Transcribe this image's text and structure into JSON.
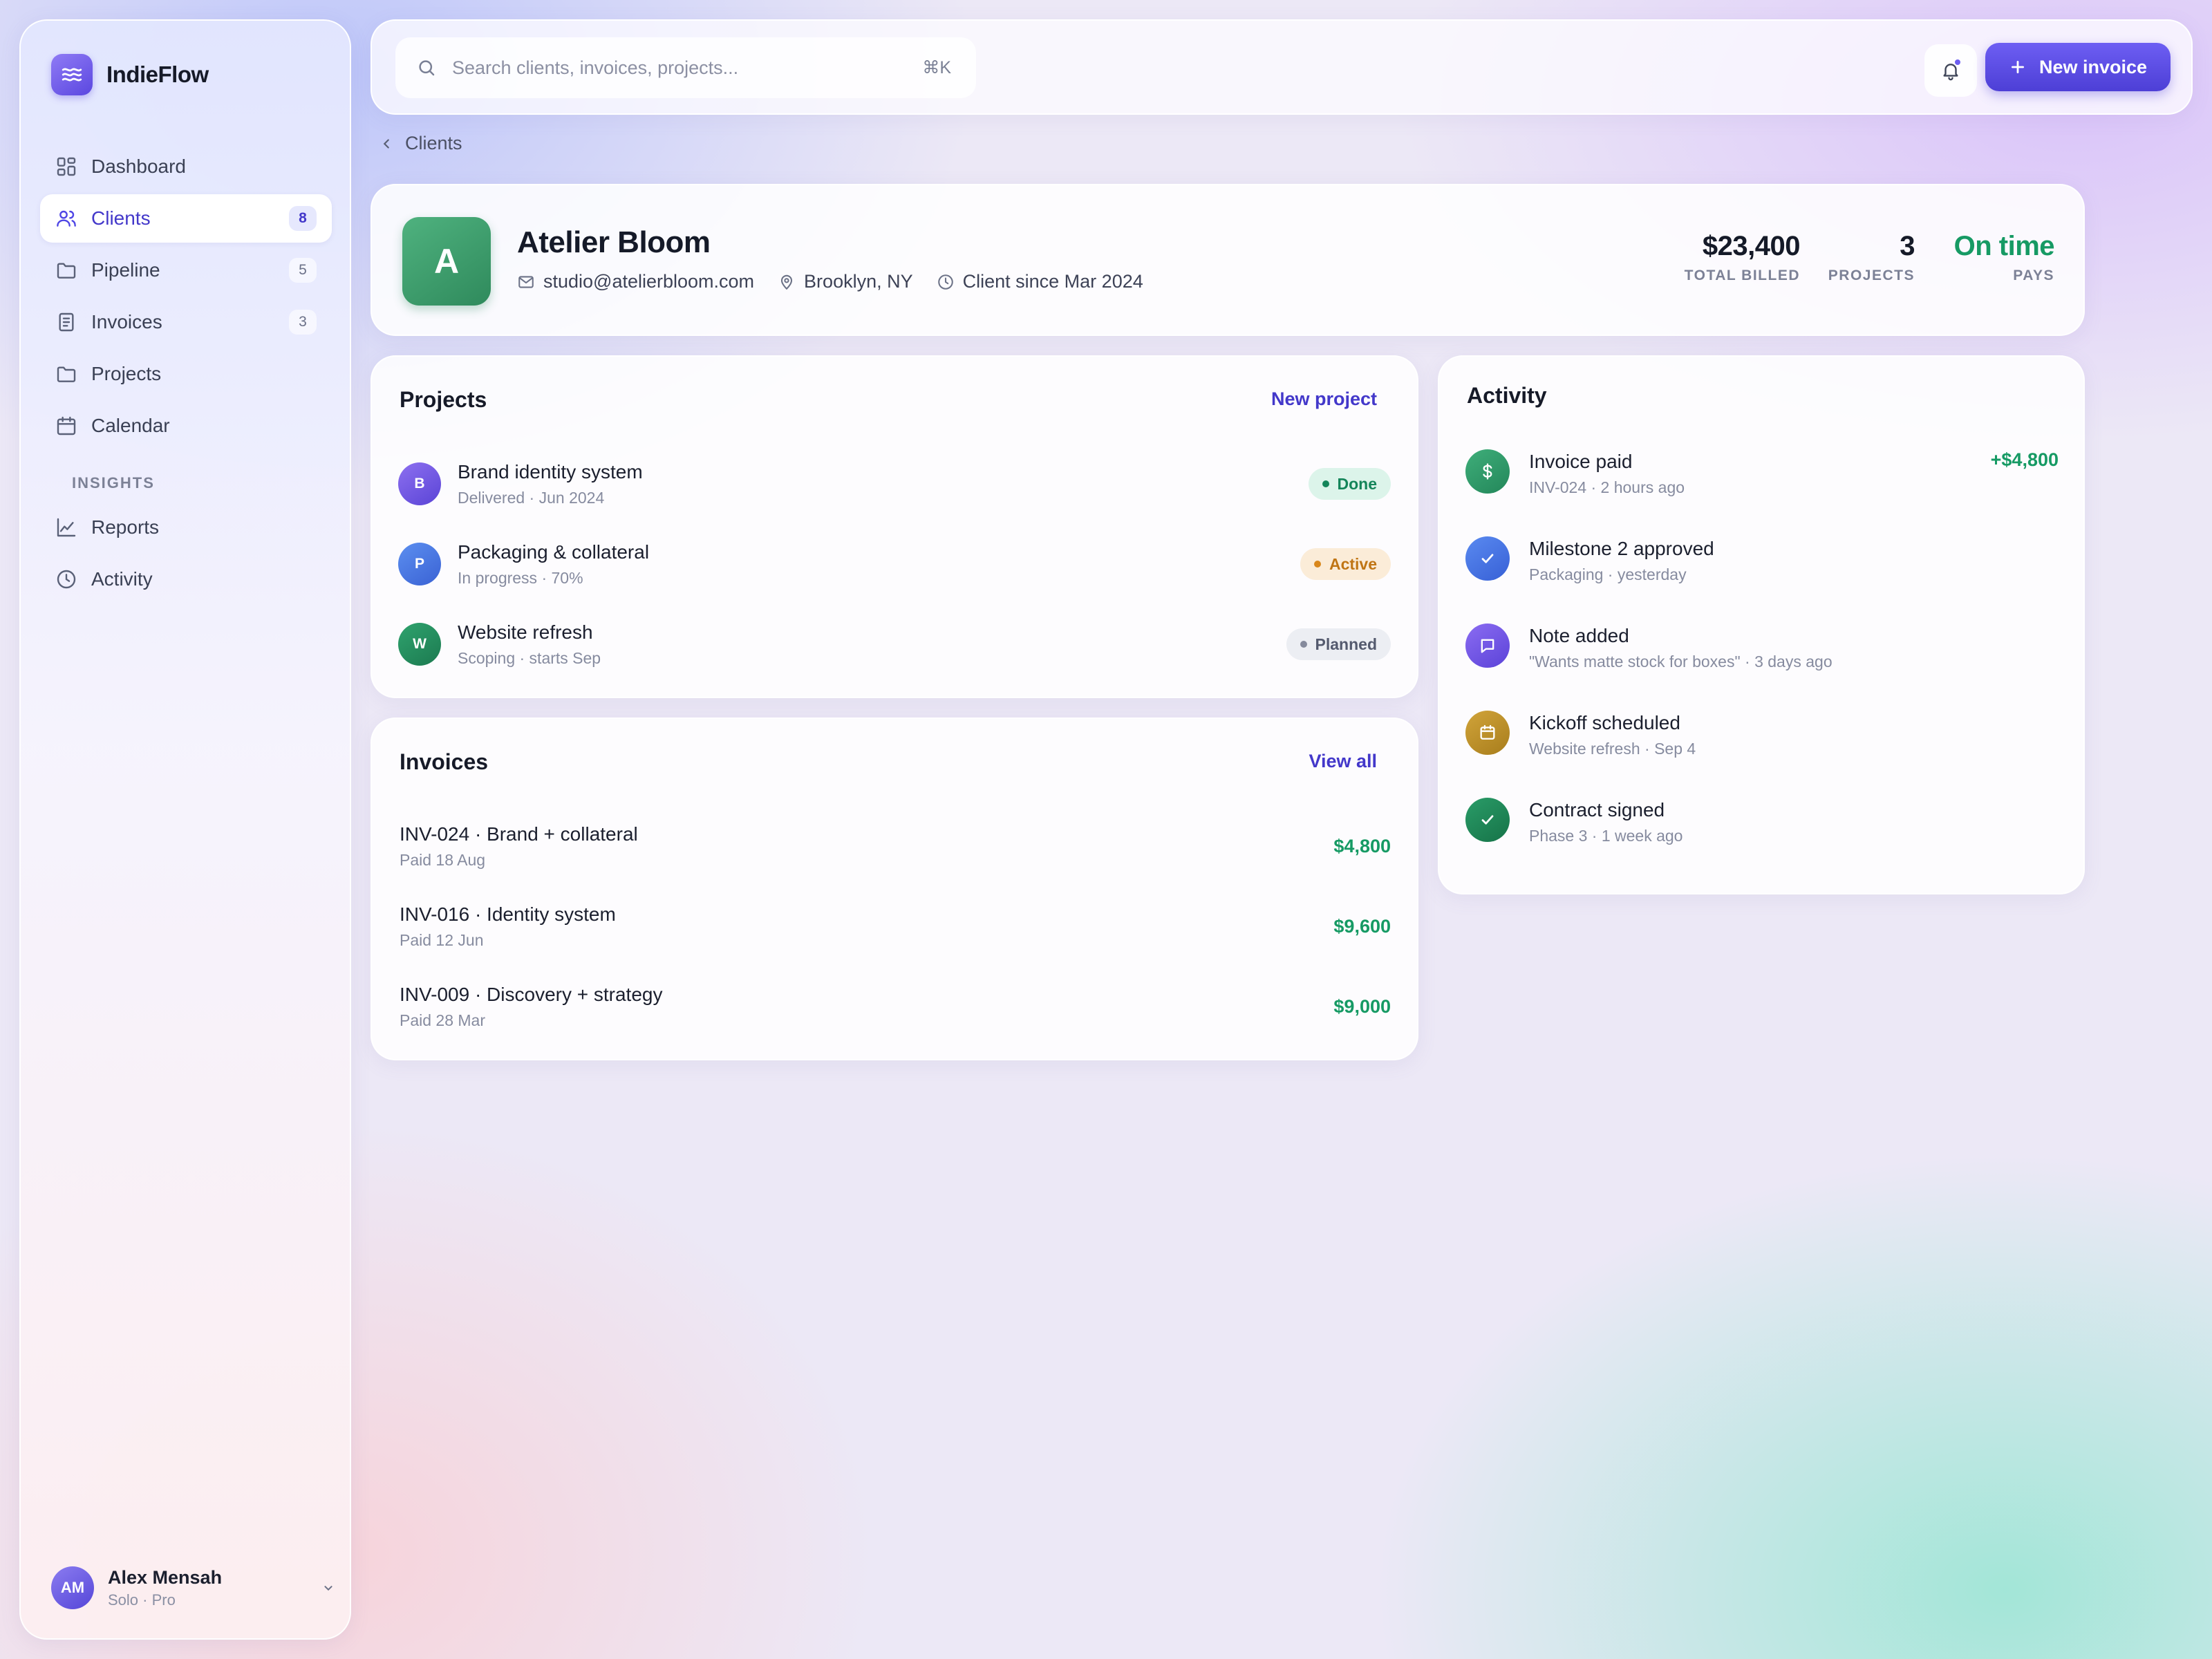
{
  "app": {
    "name": "IndieFlow"
  },
  "sidebar": {
    "items": [
      {
        "label": "Dashboard",
        "icon": "grid-icon"
      },
      {
        "label": "Clients",
        "icon": "users-icon",
        "badge": "8"
      },
      {
        "label": "Pipeline",
        "icon": "folder-icon",
        "badge": "5"
      },
      {
        "label": "Invoices",
        "icon": "document-icon",
        "badge": "3"
      },
      {
        "label": "Projects",
        "icon": "folder-icon"
      },
      {
        "label": "Calendar",
        "icon": "calendar-icon"
      }
    ],
    "section_label": "INSIGHTS",
    "insights": [
      {
        "label": "Reports",
        "icon": "chart-line-icon"
      },
      {
        "label": "Activity",
        "icon": "clock-icon"
      }
    ],
    "user": {
      "initials": "AM",
      "name": "Alex Mensah",
      "plan": "Solo · Pro"
    }
  },
  "topbar": {
    "search_placeholder": "Search clients, invoices, projects...",
    "shortcut": "⌘K",
    "new_invoice_label": "New invoice"
  },
  "breadcrumb": {
    "label": "Clients"
  },
  "client": {
    "initial": "A",
    "name": "Atelier Bloom",
    "email": "studio@atelierbloom.com",
    "location": "Brooklyn, NY",
    "since": "Client since Mar 2024",
    "stats": [
      {
        "value": "$23,400",
        "label": "TOTAL BILLED"
      },
      {
        "value": "3",
        "label": "PROJECTS"
      },
      {
        "value": "On time",
        "label": "PAYS"
      }
    ]
  },
  "projects": {
    "title": "Projects",
    "action": "New project",
    "rows": [
      {
        "initial": "B",
        "title": "Brand identity system",
        "sub": "Delivered · Jun 2024",
        "status": "Done"
      },
      {
        "initial": "P",
        "title": "Packaging & collateral",
        "sub": "In progress · 70%",
        "status": "Active"
      },
      {
        "initial": "W",
        "title": "Website refresh",
        "sub": "Scoping · starts Sep",
        "status": "Planned"
      }
    ]
  },
  "invoices": {
    "title": "Invoices",
    "action": "View all",
    "rows": [
      {
        "title": "INV-024 · Brand + collateral",
        "sub": "Paid 18 Aug",
        "amount": "$4,800"
      },
      {
        "title": "INV-016 · Identity system",
        "sub": "Paid 12 Jun",
        "amount": "$9,600"
      },
      {
        "title": "INV-009 · Discovery + strategy",
        "sub": "Paid 28 Mar",
        "amount": "$9,000"
      }
    ]
  },
  "activity": {
    "title": "Activity",
    "rows": [
      {
        "icon": "dollar-icon",
        "title": "Invoice paid",
        "sub": "INV-024 · 2 hours ago",
        "amount": "+$4,800"
      },
      {
        "icon": "check-icon",
        "title": "Milestone 2 approved",
        "sub": "Packaging · yesterday"
      },
      {
        "icon": "message-icon",
        "title": "Note added",
        "sub": "\"Wants matte stock for boxes\" · 3 days ago"
      },
      {
        "icon": "calendar-icon",
        "title": "Kickoff scheduled",
        "sub": "Website refresh · Sep 4"
      },
      {
        "icon": "check-icon",
        "title": "Contract signed",
        "sub": "Phase 3 · 1 week ago"
      }
    ]
  },
  "colors": {
    "accent": "#4f46e5",
    "success": "#169a64",
    "warning": "#d9871b",
    "client_avatar": "#3a9b6b"
  }
}
